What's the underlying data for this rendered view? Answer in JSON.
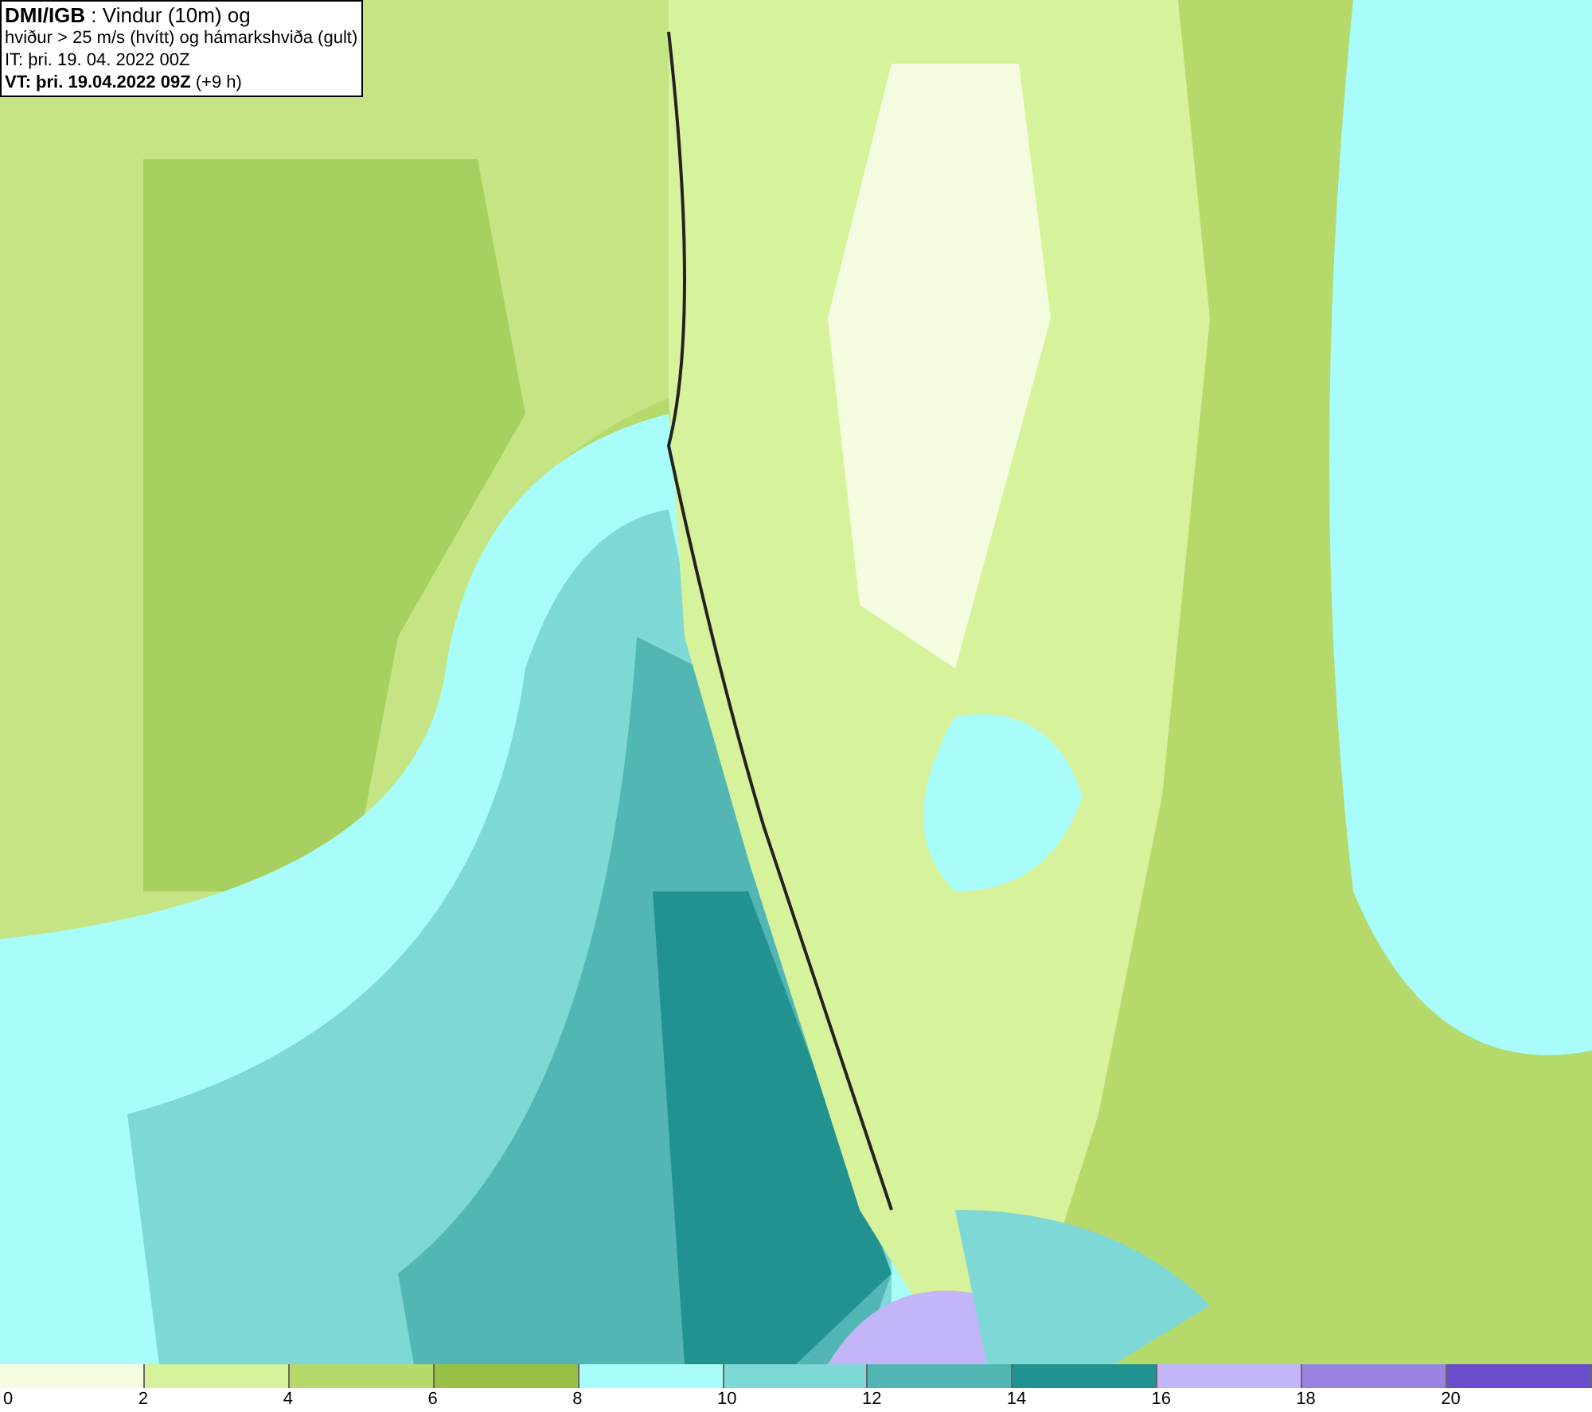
{
  "info_box": {
    "lines": [
      "**DMI/IGB** : Vindur (10m) og",
      "hviður > 25 m/s (hvítt) og hámarkshviða (gult)",
      "IT: þri. 19. 04. 2022 00Z",
      "**VT: þri. 19.04.2022 09Z** (+9 h)"
    ]
  },
  "legend": {
    "bins": [
      {
        "color": "#f5fde0"
      },
      {
        "color": "#d6f29a"
      },
      {
        "color": "#b5d96b"
      },
      {
        "color": "#97c045"
      },
      {
        "color": "#a8fdfb"
      },
      {
        "color": "#7ed8d6"
      },
      {
        "color": "#52b6b4"
      },
      {
        "color": "#229290"
      },
      {
        "color": "#c3b5f7"
      },
      {
        "color": "#9a82e0"
      },
      {
        "color": "#6b4ccc"
      }
    ],
    "ticks": [
      "0",
      "2",
      "4",
      "6",
      "8",
      "10",
      "12",
      "14",
      "16",
      "18",
      "20"
    ]
  }
}
